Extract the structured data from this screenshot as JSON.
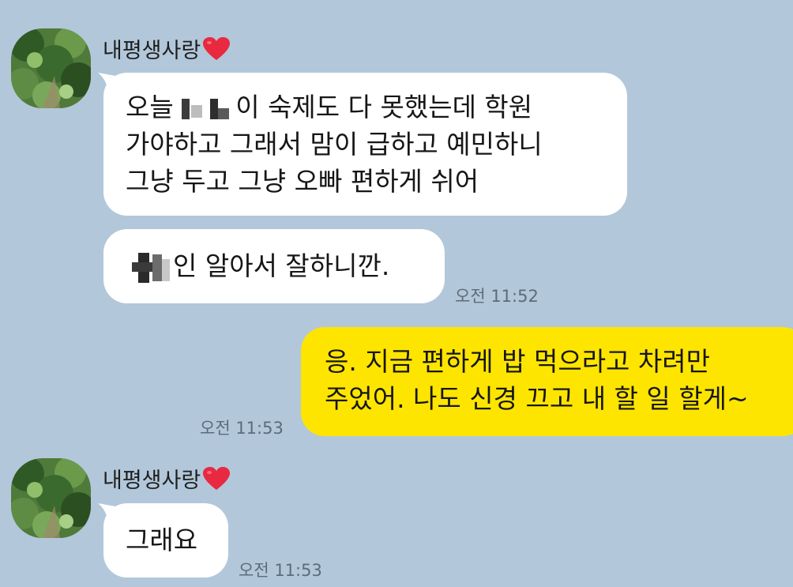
{
  "messages": [
    {
      "sender": "내평생사랑",
      "lines": [
        "오늘 ",
        "이 숙제도 다 못했는데 학원",
        "가야하고 그래서 맘이 급하고 예민하니",
        "그냥 두고 그냥 오빠 편하게 쉬어"
      ],
      "direction": "incoming"
    },
    {
      "text": "인 알아서 잘하니깐.",
      "time": "오전 11:52",
      "direction": "incoming"
    },
    {
      "lines": [
        "응. 지금 편하게 밥 먹으라고 차려만",
        "주었어. 나도 신경 끄고 내 할 일 할게~"
      ],
      "time": "오전 11:53",
      "direction": "outgoing"
    },
    {
      "sender": "내평생사랑",
      "text": "그래요",
      "time": "오전 11:53",
      "direction": "incoming"
    }
  ],
  "colors": {
    "background": "#b2c7da",
    "incoming_bubble": "#ffffff",
    "outgoing_bubble": "#fee500",
    "heart": "#e8293f"
  },
  "icons": {
    "avatar": "profile-photo-forest",
    "heart": "red-heart-emoji"
  }
}
